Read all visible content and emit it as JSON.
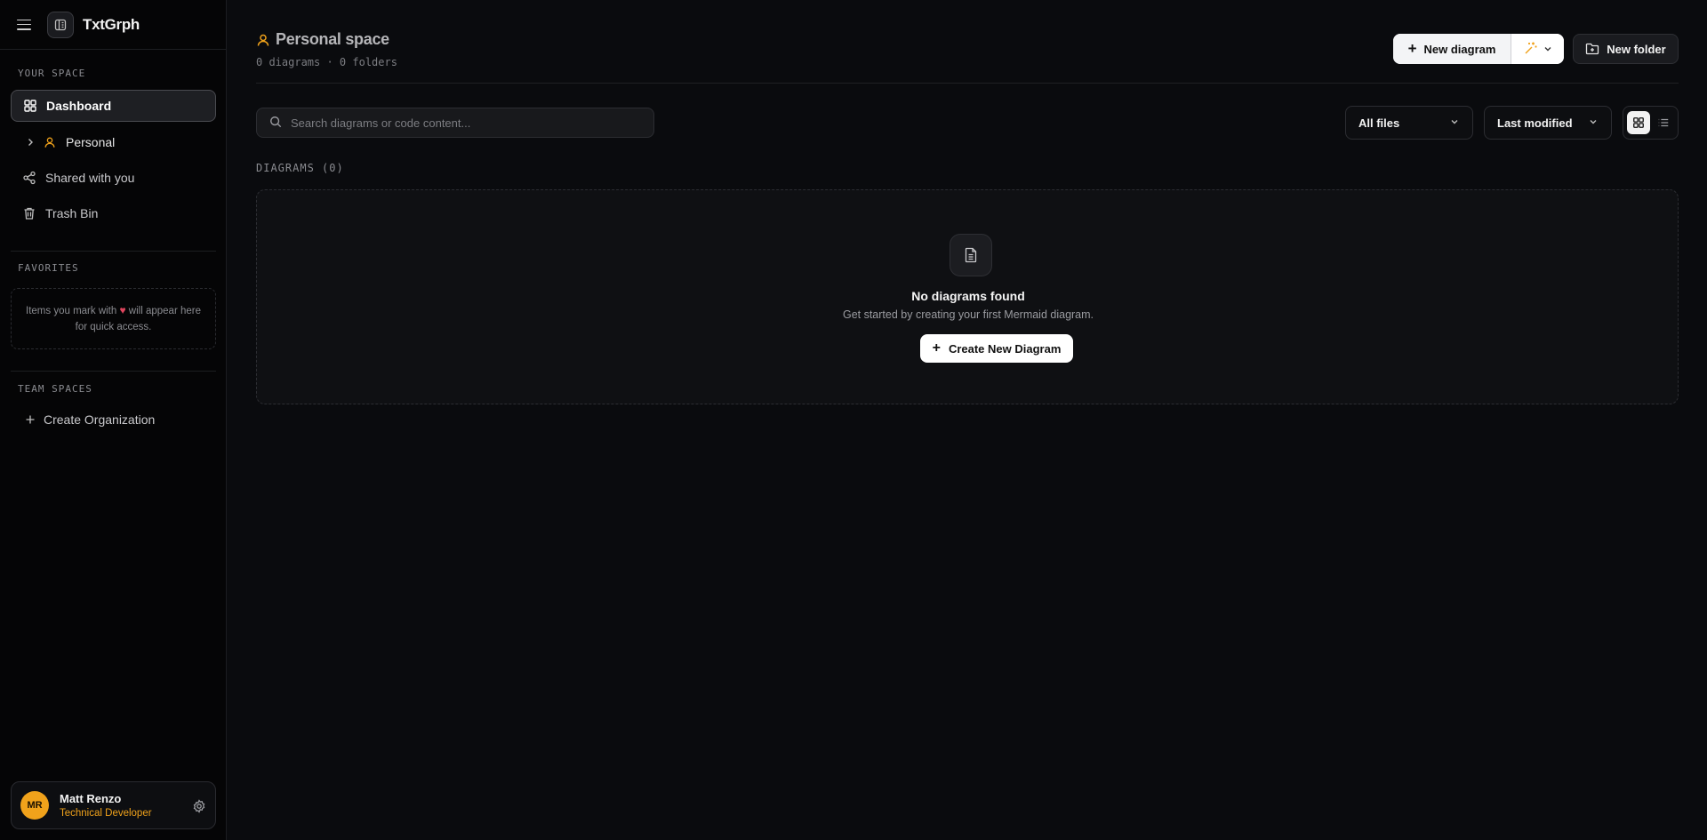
{
  "app": {
    "title": "TxtGrph"
  },
  "sidebar": {
    "your_space_label": "YOUR SPACE",
    "items": [
      {
        "label": "Dashboard",
        "icon": "dashboard-icon",
        "active": true
      },
      {
        "label": "Personal",
        "icon": "user-icon"
      },
      {
        "label": "Shared with you",
        "icon": "share-icon"
      },
      {
        "label": "Trash Bin",
        "icon": "trash-icon"
      }
    ],
    "favorites_label": "FAVORITES",
    "favorites_empty_pre": "Items you mark with",
    "favorites_empty_post": "will appear here for quick access.",
    "team_spaces_label": "TEAM SPACES",
    "create_org_label": "Create Organization"
  },
  "user": {
    "initials": "MR",
    "name": "Matt Renzo",
    "role": "Technical Developer"
  },
  "header": {
    "title": "Personal space",
    "subtitle": "0 diagrams · 0 folders",
    "new_diagram_label": "New diagram",
    "new_folder_label": "New folder"
  },
  "filters": {
    "search_placeholder": "Search diagrams or code content...",
    "search_value": "",
    "file_filter": "All files",
    "sort": "Last modified",
    "view": "grid"
  },
  "diagrams": {
    "section_label": "DIAGRAMS (0)",
    "empty_title": "No diagrams found",
    "empty_desc": "Get started by creating your first Mermaid diagram.",
    "create_label": "Create New Diagram"
  },
  "colors": {
    "accent": "#f0a21b",
    "background": "#0a0b0e",
    "sidebar": "#050506",
    "heart": "#e0455e"
  }
}
